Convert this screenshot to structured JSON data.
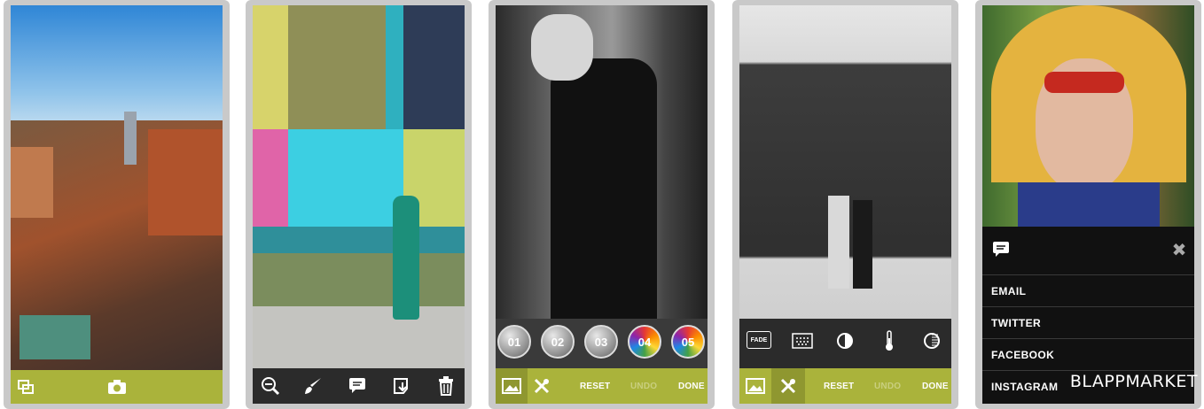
{
  "screens": {
    "camera": {
      "toolbar": {
        "left_icon": "layers-icon",
        "center_icon": "camera-icon"
      }
    },
    "edit": {
      "toolbar": [
        "zoom-out-icon",
        "brush-icon",
        "comment-icon",
        "save-to-device-icon",
        "trash-icon"
      ]
    },
    "filters": {
      "filters": [
        "01",
        "02",
        "03",
        "04",
        "05"
      ],
      "bottom": {
        "reset": "RESET",
        "undo": "UNDO",
        "done": "DONE"
      }
    },
    "adjust": {
      "tools": [
        "fade-icon",
        "grain-icon",
        "contrast-icon",
        "temperature-icon",
        "saturation-icon"
      ],
      "tool_fade_label": "FADE",
      "bottom": {
        "reset": "RESET",
        "undo": "UNDO",
        "done": "DONE"
      }
    },
    "share": {
      "items": [
        "EMAIL",
        "TWITTER",
        "FACEBOOK",
        "INSTAGRAM"
      ],
      "watermark": "BLAPPMARKET"
    }
  },
  "colors": {
    "accent": "#aab33b",
    "toolbar": "#2b2b2b"
  }
}
